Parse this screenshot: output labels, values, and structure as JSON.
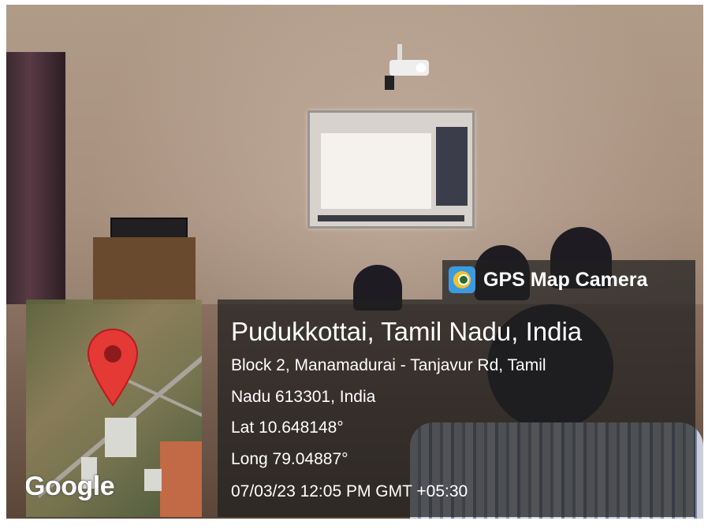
{
  "badge": {
    "app_name": "GPS Map Camera",
    "icon": "gps-map-camera-app-icon"
  },
  "map": {
    "logo_text": "Google",
    "pin_color": "#e53935",
    "pin_icon": "map-pin-icon"
  },
  "location": {
    "title": "Pudukkottai, Tamil Nadu, India",
    "address_line1": "Block 2, Manamadurai - Tanjavur Rd, Tamil",
    "address_line2": "Nadu 613301, India",
    "latitude": "Lat 10.648148°",
    "longitude": "Long 79.04887°",
    "datetime": "07/03/23 12:05 PM GMT +05:30"
  }
}
